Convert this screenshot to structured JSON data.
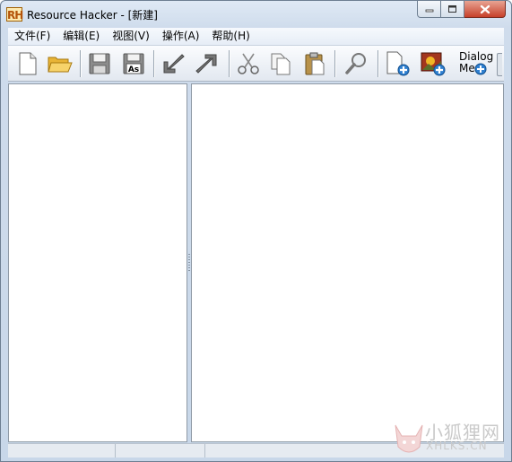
{
  "window": {
    "title": "Resource Hacker - [新建]",
    "app_icon_text": "RH"
  },
  "menu": [
    {
      "label": "文件(F)"
    },
    {
      "label": "编辑(E)"
    },
    {
      "label": "视图(V)"
    },
    {
      "label": "操作(A)"
    },
    {
      "label": "帮助(H)"
    }
  ],
  "toolbar": {
    "dialog_label_line1": "Dialog",
    "dialog_label_line2": "Me",
    "icons": [
      "new-file-icon",
      "open-folder-icon",
      "save-icon",
      "save-as-icon",
      "compile-icon",
      "import-icon",
      "cut-icon",
      "copy-icon",
      "paste-icon",
      "find-icon",
      "add-resource-icon",
      "add-image-icon",
      "dialog-merge-icon"
    ]
  },
  "watermark": {
    "text1": "小狐狸网",
    "text2": "XHLKS.CN"
  }
}
